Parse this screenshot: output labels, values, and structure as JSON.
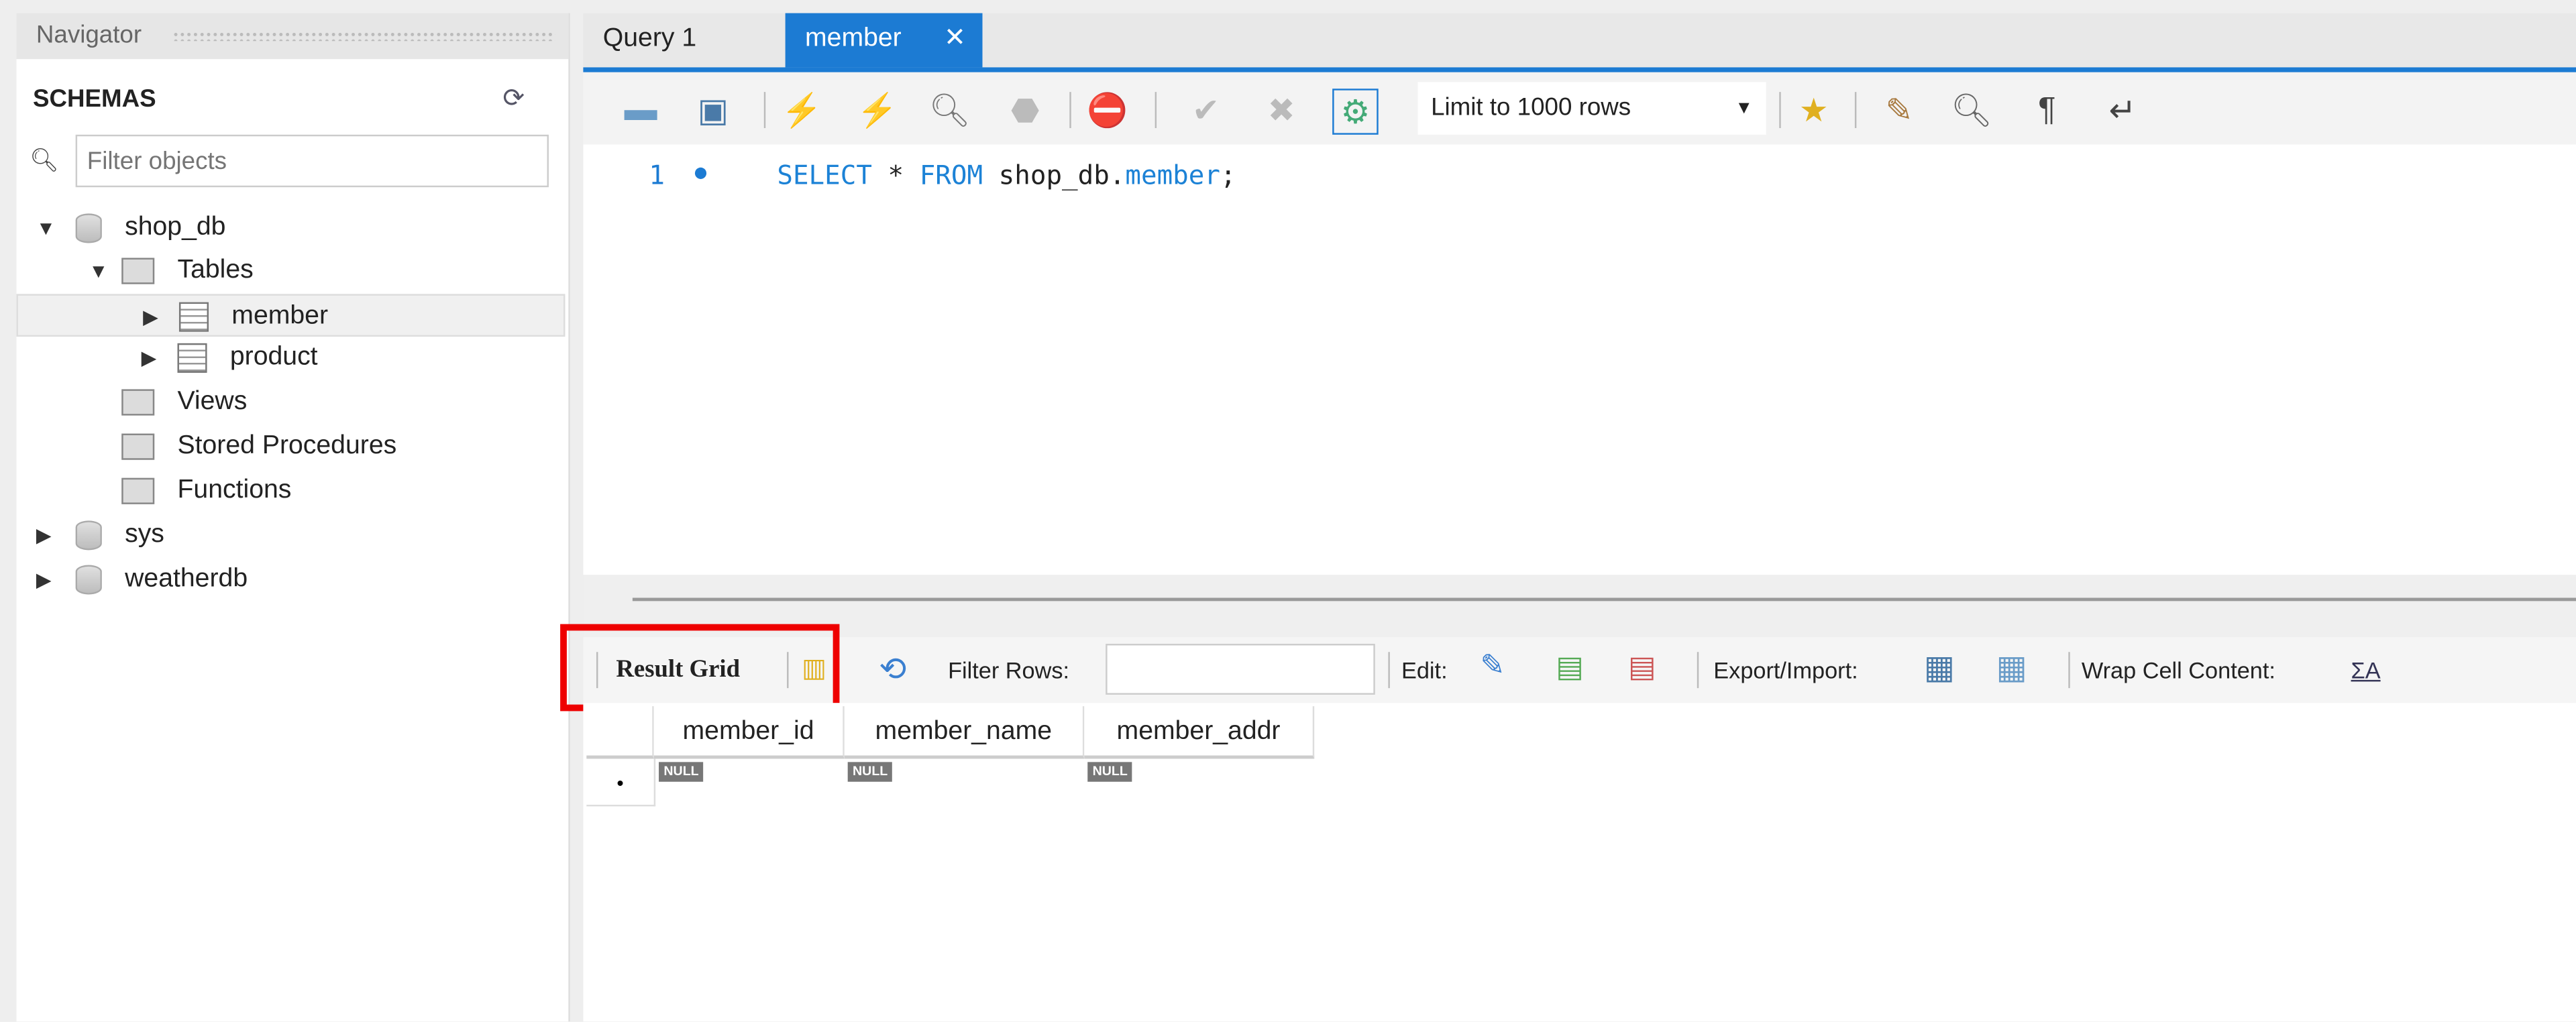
{
  "navigator": {
    "title": "Navigator",
    "schemas_label": "SCHEMAS",
    "filter_placeholder": "Filter objects",
    "tree": [
      {
        "label": "shop_db",
        "type": "schema",
        "expanded": true
      },
      {
        "label": "Tables",
        "type": "folder",
        "expanded": true
      },
      {
        "label": "member",
        "type": "table",
        "selected": true
      },
      {
        "label": "product",
        "type": "table"
      },
      {
        "label": "Views",
        "type": "folder"
      },
      {
        "label": "Stored Procedures",
        "type": "folder"
      },
      {
        "label": "Functions",
        "type": "folder"
      },
      {
        "label": "sys",
        "type": "schema"
      },
      {
        "label": "weatherdb",
        "type": "schema"
      }
    ]
  },
  "tabs": [
    {
      "label": "Query 1"
    },
    {
      "label": "member",
      "active": true,
      "close": "✕"
    }
  ],
  "toolbar": {
    "limit": "Limit to 1000 rows"
  },
  "editor": {
    "line_number": "1",
    "kw1": "SELECT",
    "star": " * ",
    "kw2": "FROM",
    "schema": " shop_db.",
    "table": "member",
    "semi": ";"
  },
  "result_toolbar": {
    "result_grid": "Result Grid",
    "filter_rows": "Filter Rows:",
    "edit": "Edit:",
    "export_import": "Export/Import:",
    "wrap": "Wrap Cell Content:",
    "wrap_icon": "ΣA"
  },
  "grid": {
    "columns": [
      "member_id",
      "member_name",
      "member_addr"
    ],
    "null_label": "NULL",
    "new_row_marker": "•"
  },
  "colors": {
    "accent": "#1c7bd3",
    "highlight": "#ee0000",
    "keyword": "#1c82d6"
  }
}
